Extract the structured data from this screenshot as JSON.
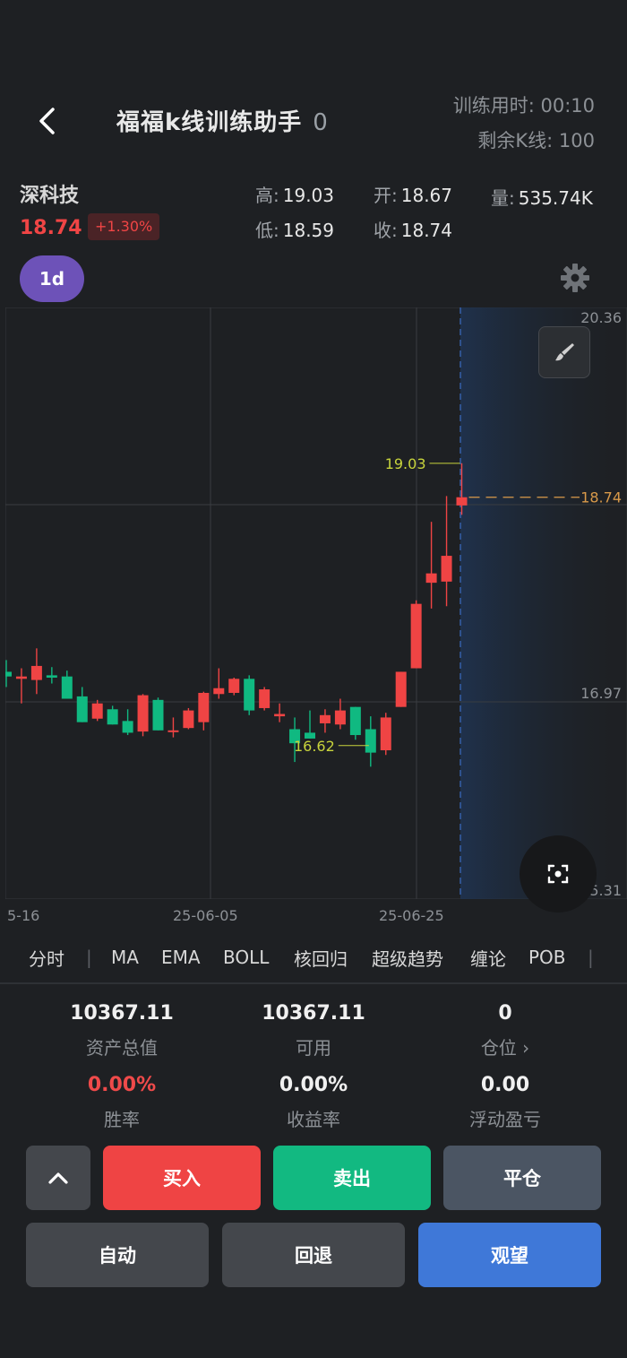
{
  "header": {
    "title": "福福k线训练助手",
    "count": "0",
    "train_time_label": "训练用时:",
    "train_time_value": "00:10",
    "remain_label": "剩余K线:",
    "remain_value": "100"
  },
  "stock": {
    "name": "深科技",
    "price": "18.74",
    "change": "+1.30%",
    "high_label": "高:",
    "high": "19.03",
    "low_label": "低:",
    "low": "18.59",
    "open_label": "开:",
    "open": "18.67",
    "close_label": "收:",
    "close": "18.74",
    "vol_label": "量:",
    "vol": "535.74K"
  },
  "period": "1d",
  "chart_data": {
    "type": "candlestick",
    "ylim": [
      15.31,
      20.36
    ],
    "y_tick_labels": [
      "20.36",
      "16.97",
      "15.31"
    ],
    "x_tick_labels": [
      "5-16",
      "25-06-05",
      "25-06-25"
    ],
    "annotations": {
      "high": "19.03",
      "low": "16.62",
      "last": "18.74"
    },
    "candles": [
      {
        "o": 17.25,
        "h": 17.35,
        "l": 17.12,
        "c": 17.21
      },
      {
        "o": 17.19,
        "h": 17.28,
        "l": 16.98,
        "c": 17.21
      },
      {
        "o": 17.18,
        "h": 17.45,
        "l": 17.06,
        "c": 17.3
      },
      {
        "o": 17.22,
        "h": 17.29,
        "l": 17.15,
        "c": 17.2
      },
      {
        "o": 17.21,
        "h": 17.26,
        "l": 17.1,
        "c": 17.02
      },
      {
        "o": 17.04,
        "h": 17.12,
        "l": 16.82,
        "c": 16.82
      },
      {
        "o": 16.85,
        "h": 17.01,
        "l": 16.83,
        "c": 16.98
      },
      {
        "o": 16.93,
        "h": 16.96,
        "l": 16.8,
        "c": 16.8
      },
      {
        "o": 16.83,
        "h": 16.93,
        "l": 16.71,
        "c": 16.73
      },
      {
        "o": 16.74,
        "h": 17.06,
        "l": 16.7,
        "c": 17.05
      },
      {
        "o": 17.01,
        "h": 17.03,
        "l": 16.75,
        "c": 16.75
      },
      {
        "o": 16.75,
        "h": 16.86,
        "l": 16.69,
        "c": 16.75
      },
      {
        "o": 16.77,
        "h": 16.94,
        "l": 16.76,
        "c": 16.92
      },
      {
        "o": 16.82,
        "h": 17.08,
        "l": 16.75,
        "c": 17.07
      },
      {
        "o": 17.06,
        "h": 17.28,
        "l": 17.02,
        "c": 17.11
      },
      {
        "o": 17.07,
        "h": 17.2,
        "l": 17.05,
        "c": 17.19
      },
      {
        "o": 17.19,
        "h": 17.22,
        "l": 16.88,
        "c": 16.92
      },
      {
        "o": 16.94,
        "h": 17.12,
        "l": 16.92,
        "c": 17.1
      },
      {
        "o": 16.87,
        "h": 16.98,
        "l": 16.82,
        "c": 16.89
      },
      {
        "o": 16.76,
        "h": 16.86,
        "l": 16.48,
        "c": 16.64
      },
      {
        "o": 16.73,
        "h": 16.92,
        "l": 16.68,
        "c": 16.68
      },
      {
        "o": 16.81,
        "h": 16.93,
        "l": 16.73,
        "c": 16.88
      },
      {
        "o": 16.8,
        "h": 17.02,
        "l": 16.76,
        "c": 16.92
      },
      {
        "o": 16.95,
        "h": 16.91,
        "l": 16.67,
        "c": 16.71
      },
      {
        "o": 16.76,
        "h": 16.87,
        "l": 16.44,
        "c": 16.56
      },
      {
        "o": 16.58,
        "h": 16.9,
        "l": 16.54,
        "c": 16.86
      },
      {
        "o": 16.95,
        "h": 17.14,
        "l": 16.95,
        "c": 17.25
      },
      {
        "o": 17.28,
        "h": 17.86,
        "l": 17.28,
        "c": 17.83
      },
      {
        "o": 18.01,
        "h": 18.53,
        "l": 17.79,
        "c": 18.09
      },
      {
        "o": 18.02,
        "h": 18.75,
        "l": 17.81,
        "c": 18.24
      },
      {
        "o": 18.67,
        "h": 19.03,
        "l": 18.59,
        "c": 18.74
      }
    ],
    "future_zone_from_index": 30
  },
  "tabs": [
    "分时",
    "MA",
    "EMA",
    "BOLL",
    "核回归",
    "超级趋势",
    "缠论",
    "POB"
  ],
  "tab_separator": "|",
  "stats": {
    "total_assets": "10367.11",
    "total_assets_label": "资产总值",
    "available": "10367.11",
    "available_label": "可用",
    "position": "0",
    "position_label": "仓位 ›",
    "win_rate": "0.00%",
    "win_rate_label": "胜率",
    "return_rate": "0.00%",
    "return_rate_label": "收益率",
    "floating_pnl": "0.00",
    "floating_pnl_label": "浮动盈亏"
  },
  "buttons": {
    "buy": "买入",
    "sell": "卖出",
    "close_position": "平仓",
    "auto": "自动",
    "rollback": "回退",
    "watch": "观望"
  },
  "colors": {
    "up": "#ef4444",
    "down": "#10b981",
    "accent": "#6d52b8",
    "watch": "#3f78d8"
  }
}
